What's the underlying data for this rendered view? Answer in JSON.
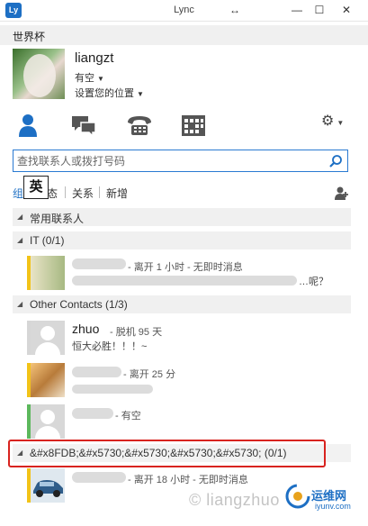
{
  "window": {
    "title": "Lync",
    "logo_text": "Ly",
    "pin_glyph": "↔",
    "min_glyph": "—",
    "max_glyph": "☐",
    "close_glyph": "✕"
  },
  "top_group": "世界杯",
  "profile": {
    "name": "liangzt",
    "status": "有空",
    "location": "设置您的位置"
  },
  "tabs": {
    "icons": [
      "contacts-icon",
      "conversations-icon",
      "phone-icon",
      "meetings-icon"
    ],
    "options_glyph": "⚙"
  },
  "search": {
    "placeholder": "查找联系人或拨打号码"
  },
  "view_tabs": {
    "groups": "组",
    "status": "态",
    "relationships": "关系",
    "new": "新增"
  },
  "ime_indicator": "英",
  "groups": [
    {
      "label": "常用联系人"
    },
    {
      "label": "IT (0/1)"
    },
    {
      "label": "Other Contacts (1/3)"
    },
    {
      "label": "&#x8FDB;&#x5730;&#x5730;&#x5730;&#x5730; (0/1)"
    }
  ],
  "contacts": [
    {
      "name": "",
      "status": "- 离开 1 小时 - 无即时消息",
      "note": "…呢？",
      "presence_color": "#f2c318"
    },
    {
      "name": "zhuo",
      "status": "- 脱机 95 天",
      "note": "恒大必胜！！！~",
      "presence_color": "#d6d6d6"
    },
    {
      "name": "",
      "status": "- 离开 25 分",
      "note": "",
      "presence_color": "#f2c318"
    },
    {
      "name": "",
      "status": "- 有空",
      "note": "",
      "presence_color": "#5cb85c"
    },
    {
      "name": "",
      "status": "- 离开 18 小时 - 无即时消息",
      "note": "",
      "presence_color": "#f2c318"
    }
  ],
  "watermark": "© liangzhuo",
  "brand": {
    "name": "运维网",
    "url": "iyunv.com"
  },
  "colors": {
    "accent": "#1d6fc4",
    "highlight_border": "#d8231f",
    "away": "#f2c318",
    "available": "#5cb85c"
  }
}
